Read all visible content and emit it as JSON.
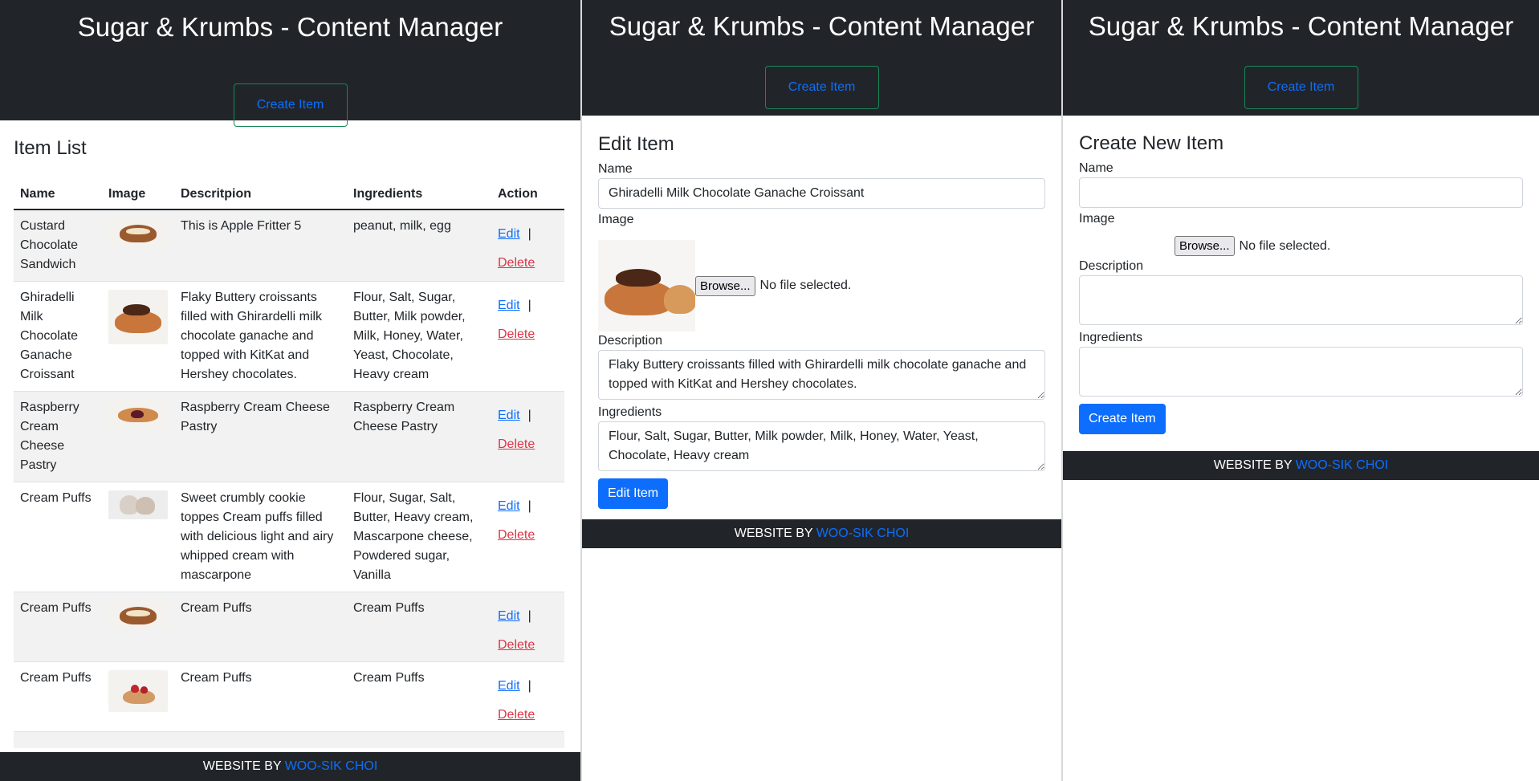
{
  "app_title": "Sugar & Krumbs - Content Manager",
  "create_button": "Create Item",
  "footer": {
    "prefix": "WEBSITE BY",
    "author": "WOO-SIK CHOI"
  },
  "list": {
    "title": "Item List",
    "columns": [
      "Name",
      "Image",
      "Descritpion",
      "Ingredients",
      "Action"
    ],
    "edit_label": "Edit",
    "delete_label": "Delete",
    "separator": "|",
    "rows": [
      {
        "name": "Custard Chocolate Sandwich",
        "image": "custard-chocolate-sandwich-photo",
        "description": "This is Apple Fritter 5",
        "ingredients": "peanut, milk, egg"
      },
      {
        "name": "Ghiradelli Milk Chocolate Ganache Croissant",
        "image": "chocolate-croissant-photo",
        "description": "Flaky Buttery croissants filled with Ghirardelli milk chocolate ganache and topped with KitKat and Hershey chocolates.",
        "ingredients": "Flour, Salt, Sugar, Butter, Milk powder, Milk, Honey, Water, Yeast, Chocolate, Heavy cream"
      },
      {
        "name": "Raspberry Cream Cheese Pastry",
        "image": "raspberry-pastry-photo",
        "description": "Raspberry Cream Cheese Pastry",
        "ingredients": "Raspberry Cream Cheese Pastry"
      },
      {
        "name": "Cream Puffs",
        "image": "cream-puffs-photo",
        "description": "Sweet crumbly cookie toppes Cream puffs filled with delicious light and airy whipped cream with mascarpone",
        "ingredients": "Flour, Sugar, Salt, Butter, Heavy cream, Mascarpone cheese, Powdered sugar, Vanilla"
      },
      {
        "name": "Cream Puffs",
        "image": "sandwich-photo",
        "description": "Cream Puffs",
        "ingredients": "Cream Puffs"
      },
      {
        "name": "Cream Puffs",
        "image": "strawberry-pastry-photo",
        "description": "Cream Puffs",
        "ingredients": "Cream Puffs"
      }
    ]
  },
  "edit_form": {
    "title": "Edit Item",
    "name_label": "Name",
    "name_value": "Ghiradelli Milk Chocolate Ganache Croissant",
    "image_label": "Image",
    "browse_label": "Browse...",
    "no_file": "No file selected.",
    "description_label": "Description",
    "description_value": "Flaky Buttery croissants filled with Ghirardelli milk chocolate ganache and topped with KitKat and Hershey chocolates.",
    "ingredients_label": "Ingredients",
    "ingredients_value": "Flour, Salt, Sugar, Butter, Milk powder, Milk, Honey, Water, Yeast, Chocolate, Heavy cream",
    "submit_label": "Edit Item"
  },
  "create_form": {
    "title": "Create New Item",
    "name_label": "Name",
    "image_label": "Image",
    "browse_label": "Browse...",
    "no_file": "No file selected.",
    "description_label": "Description",
    "ingredients_label": "Ingredients",
    "submit_label": "Create Item"
  },
  "colors": {
    "header_bg": "#212529",
    "link_blue": "#0d6efd",
    "delete_red": "#dc3545",
    "outline_green": "#198754",
    "row_stripe": "#f2f2f2"
  }
}
